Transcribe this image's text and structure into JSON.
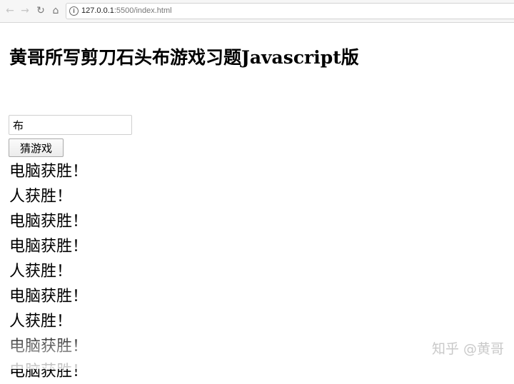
{
  "browser": {
    "back_icon": "←",
    "forward_icon": "→",
    "reload_icon": "↻",
    "home_icon": "⌂",
    "info_icon": "i",
    "url_host": "127.0.0.1",
    "url_rest": ":5500/index.html"
  },
  "page": {
    "title": "黄哥所写剪刀石头布游戏习题Javascript版",
    "input_value": "布",
    "button_label": "猜游戏",
    "results": [
      "电脑获胜！",
      "人获胜！",
      "电脑获胜！",
      "电脑获胜！",
      "人获胜！",
      "电脑获胜！",
      "人获胜！",
      "电脑获胜！",
      "电脑获胜！"
    ]
  },
  "watermark": "知乎 @黄哥"
}
